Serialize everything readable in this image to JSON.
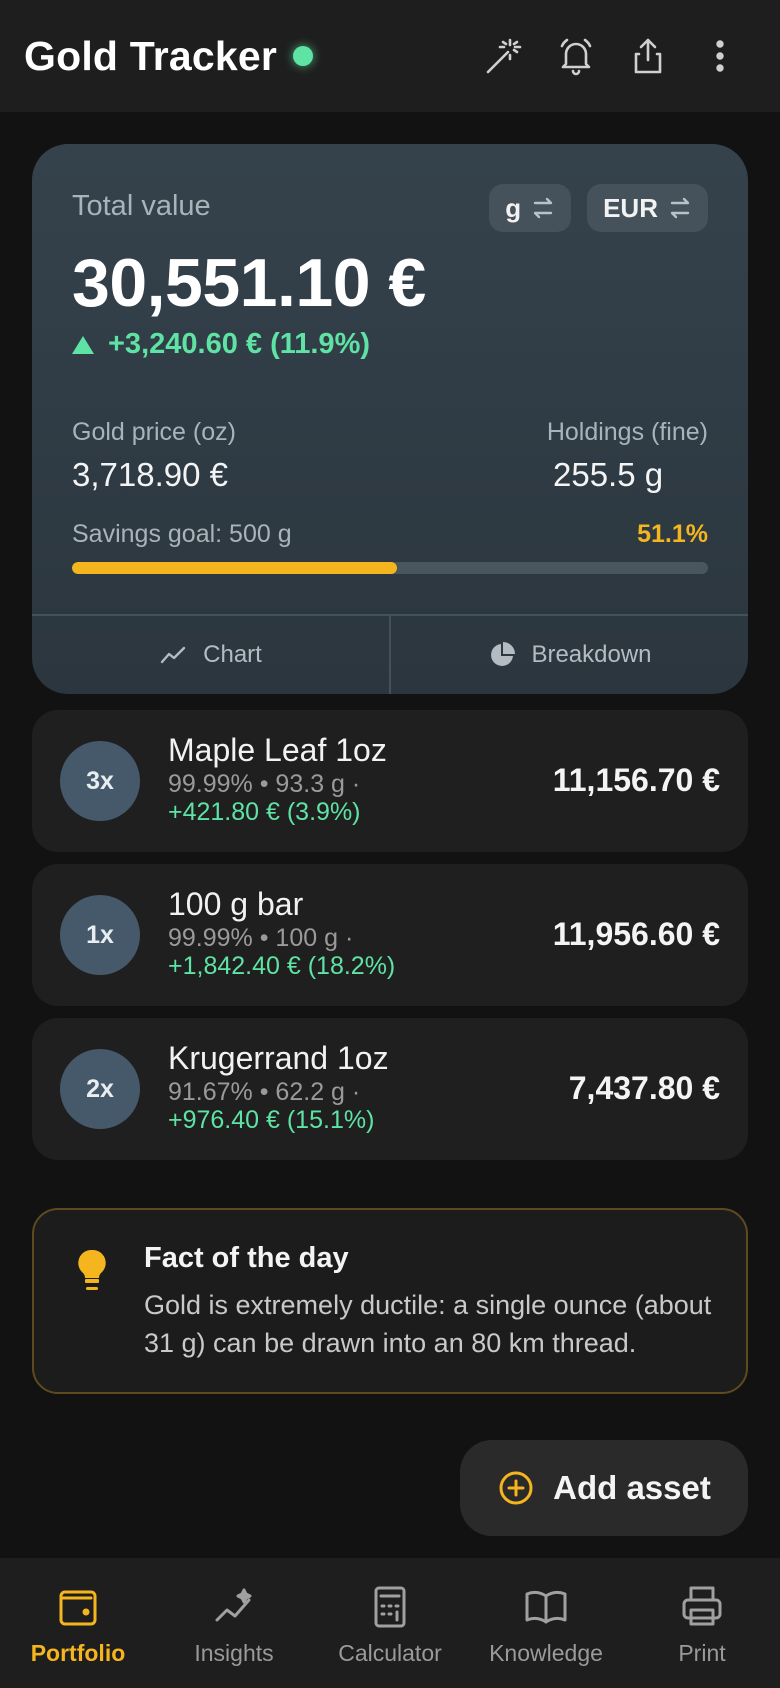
{
  "header": {
    "title": "Gold Tracker"
  },
  "summary": {
    "total_label": "Total value",
    "unit_toggle": "g",
    "currency_toggle": "EUR",
    "total_value": "30,551.10 €",
    "total_change": "+3,240.60 € (11.9%)",
    "gold_price_label": "Gold price (oz)",
    "gold_price_value": "3,718.90 €",
    "holdings_label": "Holdings (fine)",
    "holdings_value": "255.5 g",
    "goal_label": "Savings goal: 500 g",
    "goal_pct": "51.1%",
    "goal_fraction": 0.511,
    "tabs": [
      {
        "label": "Chart",
        "icon": "line-chart-icon"
      },
      {
        "label": "Breakdown",
        "icon": "pie-chart-icon"
      }
    ]
  },
  "assets": [
    {
      "qty": "3x",
      "name": "Maple Leaf 1oz",
      "meta": "99.99% • 93.3 g ·",
      "gain": "+421.80 € (3.9%)",
      "value": "11,156.70 €"
    },
    {
      "qty": "1x",
      "name": "100 g bar",
      "meta": "99.99% • 100 g ·",
      "gain": "+1,842.40 € (18.2%)",
      "value": "11,956.60 €"
    },
    {
      "qty": "2x",
      "name": "Krugerrand 1oz",
      "meta": "91.67% • 62.2 g ·",
      "gain": "+976.40 € (15.1%)",
      "value": "7,437.80 €"
    }
  ],
  "fact": {
    "title": "Fact of the day",
    "text": "Gold is extremely ductile: a single ounce (about 31 g) can be drawn into an 80 km thread."
  },
  "fab": {
    "label": "Add asset"
  },
  "nav": [
    {
      "label": "Portfolio",
      "icon": "wallet-icon",
      "active": true
    },
    {
      "label": "Insights",
      "icon": "insights-icon",
      "active": false
    },
    {
      "label": "Calculator",
      "icon": "calculator-icon",
      "active": false
    },
    {
      "label": "Knowledge",
      "icon": "book-icon",
      "active": false
    },
    {
      "label": "Print",
      "icon": "printer-icon",
      "active": false
    }
  ],
  "colors": {
    "accent": "#f5b51f",
    "positive": "#5ee3a4",
    "background": "#121212",
    "card": "#2b363e"
  }
}
